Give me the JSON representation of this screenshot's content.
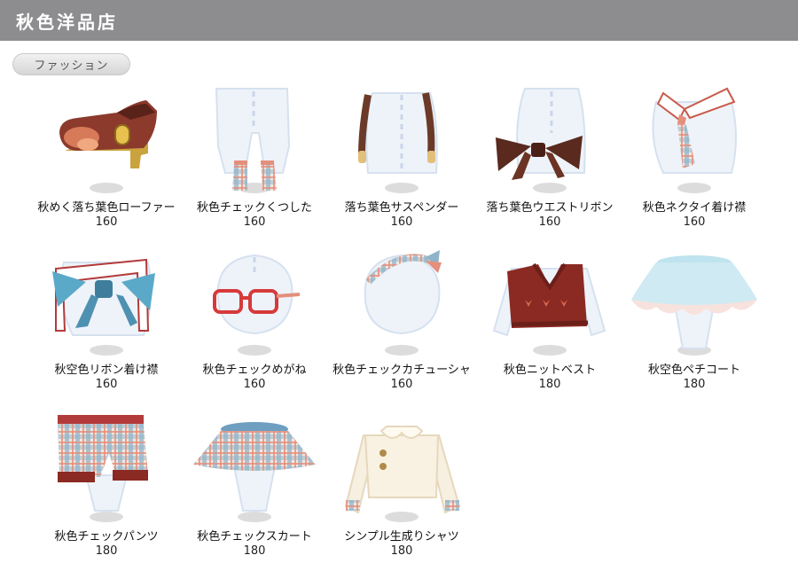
{
  "shop_title": "秋色洋品店",
  "category_tab": "ファッション",
  "colors": {
    "title_bar": "#8d8c8f",
    "title_text": "#ffffff"
  },
  "items": [
    {
      "name": "秋めく落ち葉色ローファー",
      "price": "160",
      "icon": "loafer-icon"
    },
    {
      "name": "秋色チェックくつした",
      "price": "160",
      "icon": "socks-icon"
    },
    {
      "name": "落ち葉色サスペンダー",
      "price": "160",
      "icon": "suspenders-icon"
    },
    {
      "name": "落ち葉色ウエストリボン",
      "price": "160",
      "icon": "waist-ribbon-icon"
    },
    {
      "name": "秋色ネクタイ着け襟",
      "price": "160",
      "icon": "necktie-collar-icon"
    },
    {
      "name": "秋空色リボン着け襟",
      "price": "160",
      "icon": "ribbon-collar-icon"
    },
    {
      "name": "秋色チェックめがね",
      "price": "160",
      "icon": "glasses-icon"
    },
    {
      "name": "秋色チェックカチューシャ",
      "price": "160",
      "icon": "headband-icon"
    },
    {
      "name": "秋色ニットベスト",
      "price": "180",
      "icon": "knit-vest-icon"
    },
    {
      "name": "秋空色ペチコート",
      "price": "180",
      "icon": "petticoat-icon"
    },
    {
      "name": "秋色チェックパンツ",
      "price": "180",
      "icon": "check-pants-icon"
    },
    {
      "name": "秋色チェックスカート",
      "price": "180",
      "icon": "check-skirt-icon"
    },
    {
      "name": "シンプル生成りシャツ",
      "price": "180",
      "icon": "shirt-icon"
    }
  ]
}
